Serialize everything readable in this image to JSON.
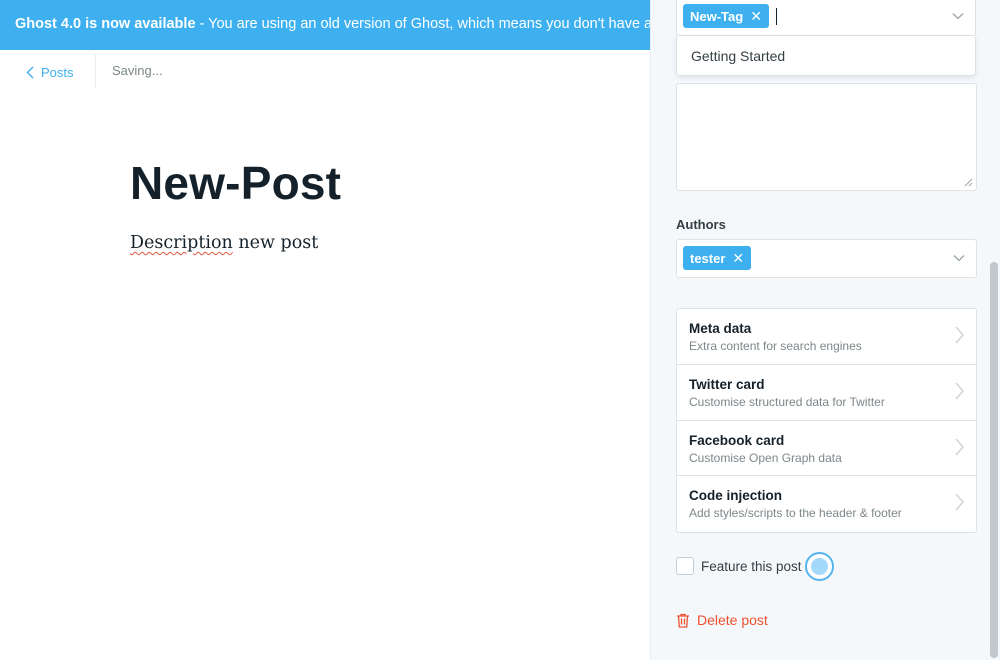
{
  "banner": {
    "strong_text": "Ghost 4.0 is now available",
    "message": " - You are using an old version of Ghost, which means you don't have access to the latest features."
  },
  "header": {
    "back_label": "Posts",
    "status": "Saving..."
  },
  "editor": {
    "title": "New-Post",
    "body_misspelled": "Description",
    "body_rest": " new post"
  },
  "settings": {
    "tags": {
      "selected": [
        "New-Tag"
      ],
      "options": [
        "Getting Started"
      ]
    },
    "authors": {
      "label": "Authors",
      "selected": [
        "tester"
      ]
    },
    "menu": [
      {
        "title": "Meta data",
        "desc": "Extra content for search engines"
      },
      {
        "title": "Twitter card",
        "desc": "Customise structured data for Twitter"
      },
      {
        "title": "Facebook card",
        "desc": "Customise Open Graph data"
      },
      {
        "title": "Code injection",
        "desc": "Add styles/scripts to the header & footer"
      }
    ],
    "feature_label": "Feature this post",
    "feature_checked": false,
    "delete_label": "Delete post"
  },
  "icons": {
    "back": "chevron-left-icon",
    "token_remove": "close-icon",
    "dropdown": "chevron-down-icon",
    "menu_arrow": "chevron-right-icon",
    "delete": "trash-icon"
  },
  "colors": {
    "accent": "#3eb0ef",
    "danger": "#f05230",
    "panel_bg": "#f4f8fb"
  }
}
